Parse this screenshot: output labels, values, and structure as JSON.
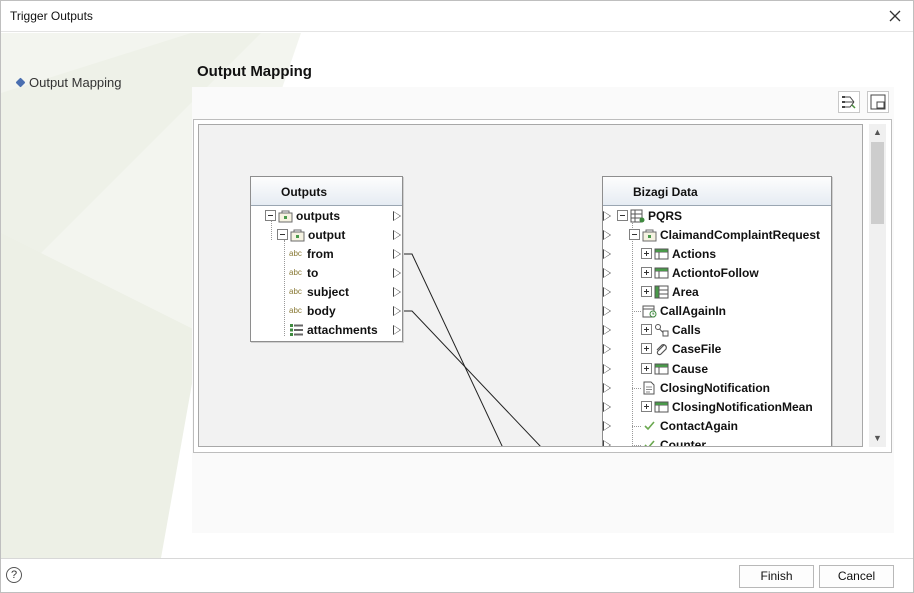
{
  "window": {
    "title": "Trigger Outputs"
  },
  "nav": {
    "items": [
      {
        "label": "Output Mapping"
      }
    ]
  },
  "main": {
    "section_title": "Output Mapping"
  },
  "toolbar": {
    "icons": [
      "auto-map-icon",
      "fit-view-icon"
    ]
  },
  "source": {
    "header": "Outputs",
    "rows": [
      {
        "label": "outputs",
        "icon": "container-icon",
        "expander": "minus"
      },
      {
        "label": "output",
        "icon": "container-icon",
        "expander": "minus"
      },
      {
        "label": "from",
        "icon": "abc-icon"
      },
      {
        "label": "to",
        "icon": "abc-icon"
      },
      {
        "label": "subject",
        "icon": "abc-icon"
      },
      {
        "label": "body",
        "icon": "abc-icon"
      },
      {
        "label": "attachments",
        "icon": "list-icon"
      }
    ]
  },
  "target": {
    "header": "Bizagi Data",
    "rows": [
      {
        "label": "PQRS",
        "icon": "entity-table-icon",
        "expander": "minus"
      },
      {
        "label": "ClaimandComplaintRequest",
        "icon": "container-icon",
        "expander": "minus"
      },
      {
        "label": "Actions",
        "icon": "table-icon",
        "expander": "plus"
      },
      {
        "label": "ActiontoFollow",
        "icon": "table-icon",
        "expander": "plus"
      },
      {
        "label": "Area",
        "icon": "table-icon",
        "expander": "plus"
      },
      {
        "label": "CallAgainIn",
        "icon": "calendar-icon"
      },
      {
        "label": "Calls",
        "icon": "relation-icon",
        "expander": "plus"
      },
      {
        "label": "CaseFile",
        "icon": "paperclip-icon",
        "expander": "plus"
      },
      {
        "label": "Cause",
        "icon": "table-icon",
        "expander": "plus"
      },
      {
        "label": "ClosingNotification",
        "icon": "document-icon"
      },
      {
        "label": "ClosingNotificationMean",
        "icon": "table-icon",
        "expander": "plus"
      },
      {
        "label": "ContactAgain",
        "icon": "check-icon"
      },
      {
        "label": "Counter",
        "icon": "check-icon"
      }
    ]
  },
  "mappings": [
    {
      "from": "from",
      "to": "off-screen"
    },
    {
      "from": "body",
      "to": "off-screen"
    }
  ],
  "footer": {
    "help_label": "?",
    "finish_label": "Finish",
    "cancel_label": "Cancel"
  },
  "colors": {
    "accent": "#4a6fb0",
    "node_header": "#e6ecf3",
    "canvas": "#f2f2f2"
  }
}
